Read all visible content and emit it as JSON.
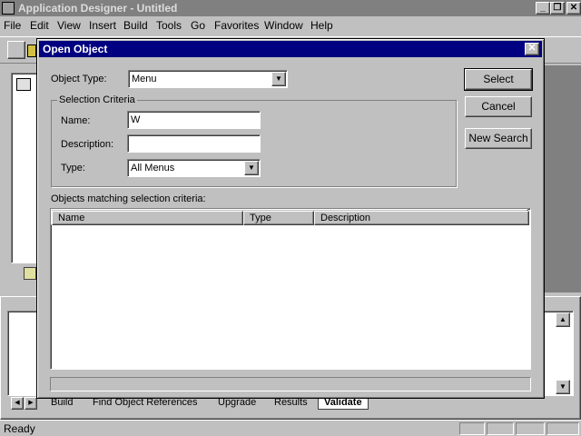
{
  "app": {
    "title": "Application Designer - Untitled",
    "menu": [
      "File",
      "Edit",
      "View",
      "Insert",
      "Build",
      "Tools",
      "Go",
      "Favorites",
      "Window",
      "Help"
    ],
    "window_controls": {
      "minimize": "_",
      "restore": "❐",
      "close": "✕"
    }
  },
  "dialog": {
    "title": "Open Object",
    "close_glyph": "✕",
    "object_type_label": "Object Type:",
    "object_type_value": "Menu",
    "selection_criteria_label": "Selection Criteria",
    "name_label": "Name:",
    "name_value": "W",
    "description_label": "Description:",
    "description_value": "",
    "type_label": "Type:",
    "type_value": "All Menus",
    "select_button": "Select",
    "cancel_button": "Cancel",
    "new_search_button": "New Search",
    "results_label": "Objects matching selection criteria:",
    "columns": [
      "Name",
      "Type",
      "Description"
    ]
  },
  "bottom": {
    "tabs": [
      "Build",
      "Find Object References",
      "Upgrade",
      "Results",
      "Validate"
    ],
    "active_tab": "Validate"
  },
  "status": {
    "text": "Ready"
  }
}
